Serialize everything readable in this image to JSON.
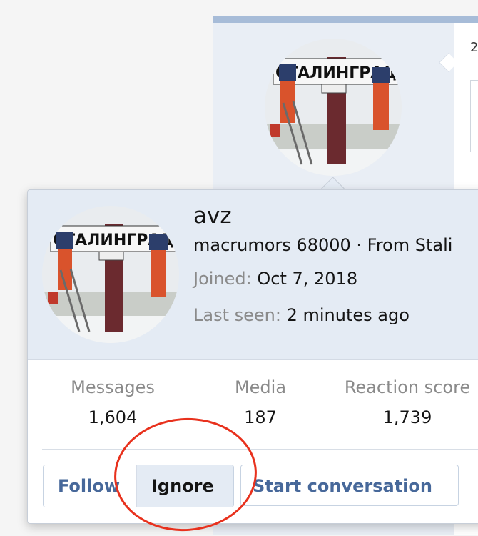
{
  "background_post": {
    "snippet": "2"
  },
  "card": {
    "username": "avz",
    "user_title": "macrumors 68000 · From Stali",
    "joined_label": "Joined:",
    "joined_value": "Oct 7, 2018",
    "last_seen_label": "Last seen:",
    "last_seen_value": "2 minutes ago",
    "avatar_sign_text": "СТАЛИНГРАД",
    "stats": [
      {
        "label": "Messages",
        "value": "1,604"
      },
      {
        "label": "Media",
        "value": "187"
      },
      {
        "label": "Reaction score",
        "value": "1,739"
      }
    ],
    "buttons": {
      "follow": "Follow",
      "ignore": "Ignore",
      "start_conversation": "Start conversation"
    }
  },
  "colors": {
    "header_bg": "#e4ebf4",
    "link_blue": "#47689a",
    "annotation_red": "#e8311d"
  }
}
